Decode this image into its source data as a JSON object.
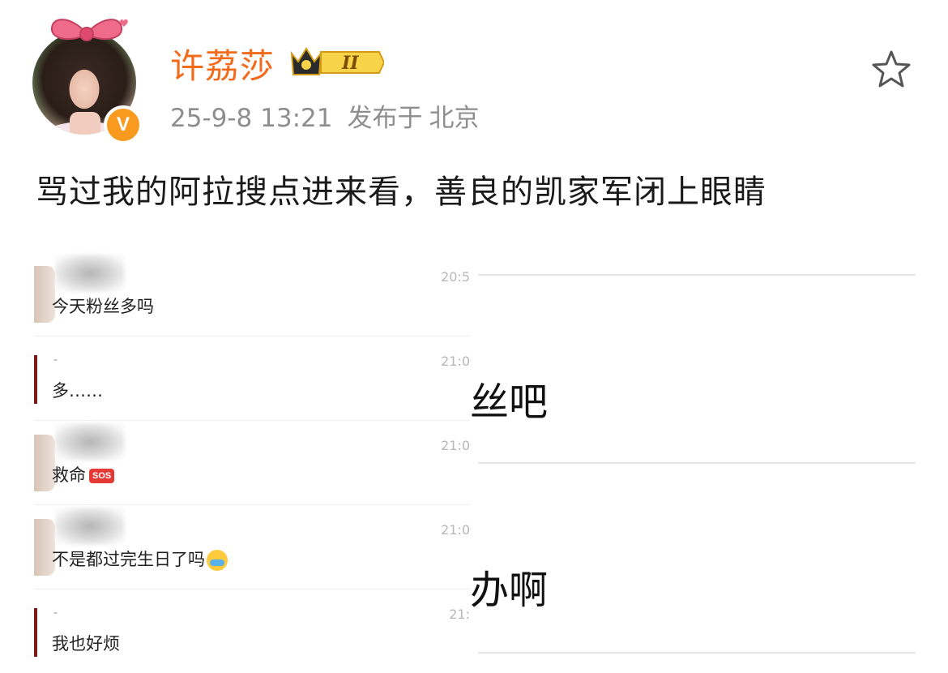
{
  "user": {
    "name": "许荔莎",
    "level_badge": "II",
    "verified_badge": "V",
    "timestamp": "25-9-8 13:21",
    "location_prefix": "发布于",
    "location": "北京"
  },
  "post": {
    "text": "骂过我的阿拉搜点进来看，善良的凯家军闭上眼睛"
  },
  "chat_screenshot": {
    "rows": [
      {
        "time": "20:5",
        "message": "今天粉丝多吗",
        "sender_mark": ""
      },
      {
        "time": "21:0",
        "message": "多……",
        "sender_mark": "-"
      },
      {
        "time": "21:0",
        "message": "救命",
        "sender_mark": "",
        "emoji": "SOS"
      },
      {
        "time": "21:0",
        "message": "不是都过完生日了吗",
        "sender_mark": ""
      },
      {
        "time": "21:",
        "message": "我也好烦",
        "sender_mark": "-"
      }
    ]
  },
  "partial_screenshot": {
    "lines": [
      "丝吧",
      "办啊"
    ]
  },
  "colors": {
    "name": "#f26a1b",
    "meta": "#8e8e8e",
    "verified": "#f79a1e",
    "bow": "#f06a8a"
  },
  "icons": {
    "favorite": "star-outline-icon",
    "crown": "crown-icon"
  }
}
